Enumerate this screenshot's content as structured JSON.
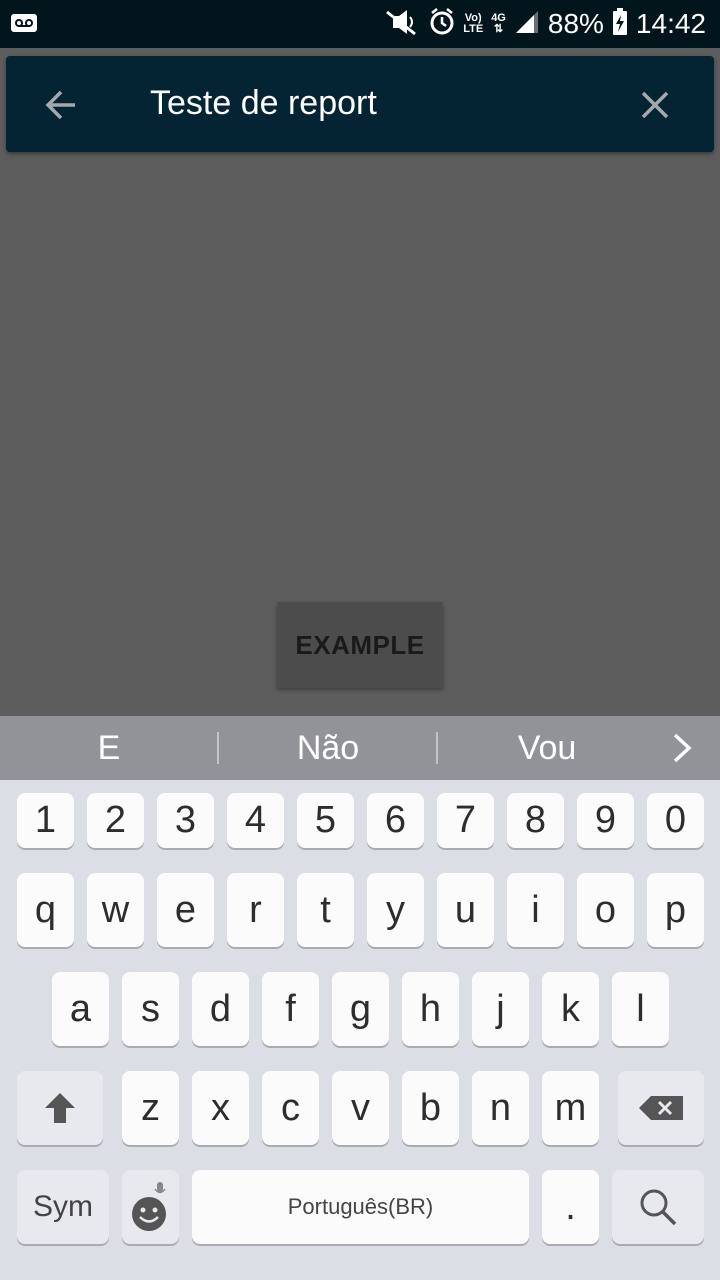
{
  "status_bar": {
    "battery": "88%",
    "time": "14:42",
    "net_vo": "Vo)",
    "net_lte": "LTE",
    "net_4g": "4G",
    "icons": [
      "voicemail-icon",
      "mute-icon",
      "alarm-icon",
      "signal-icon",
      "battery-charging-icon"
    ]
  },
  "toolbar": {
    "title": "Teste de report",
    "bg": "#042433"
  },
  "content": {
    "example_button": "EXAMPLE"
  },
  "suggestions": [
    "E",
    "Não",
    "Vou"
  ],
  "keyboard": {
    "row_numbers": [
      "1",
      "2",
      "3",
      "4",
      "5",
      "6",
      "7",
      "8",
      "9",
      "0"
    ],
    "row1": [
      "q",
      "w",
      "e",
      "r",
      "t",
      "y",
      "u",
      "i",
      "o",
      "p"
    ],
    "row2": [
      "a",
      "s",
      "d",
      "f",
      "g",
      "h",
      "j",
      "k",
      "l"
    ],
    "row3": [
      "z",
      "x",
      "c",
      "v",
      "b",
      "n",
      "m"
    ],
    "sym": "Sym",
    "space": "Português(BR)",
    "period": "."
  }
}
